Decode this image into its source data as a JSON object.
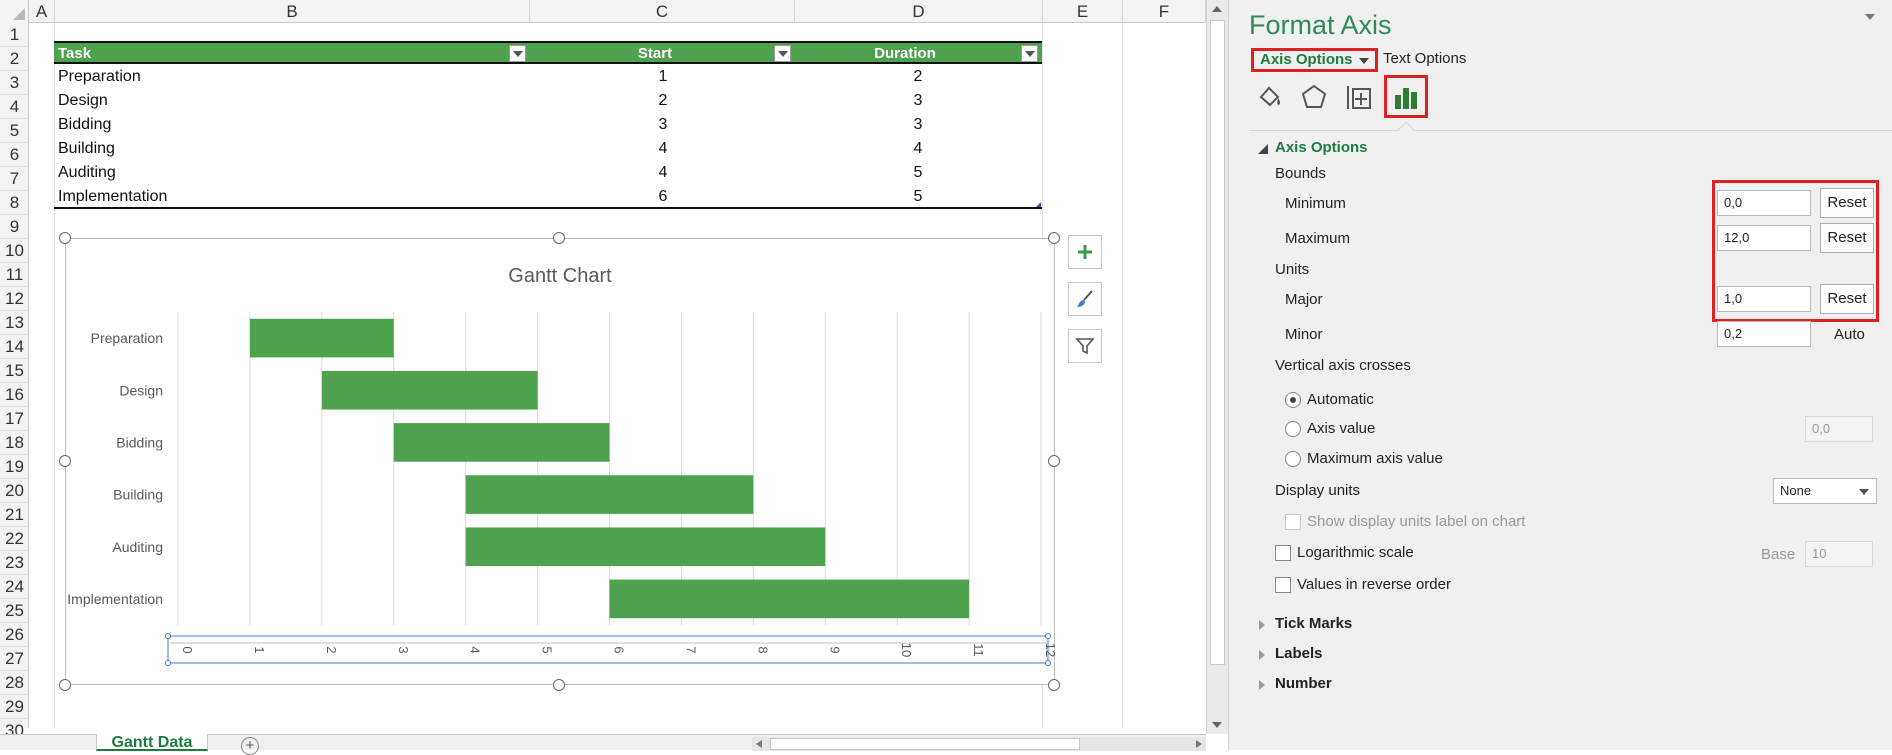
{
  "sheet": {
    "columns": [
      "A",
      "B",
      "C",
      "D",
      "E",
      "F"
    ],
    "rows": [
      "1",
      "2",
      "3",
      "4",
      "5",
      "6",
      "7",
      "8",
      "9",
      "10",
      "11",
      "12",
      "13",
      "14",
      "15",
      "16",
      "17",
      "18",
      "19",
      "20",
      "21",
      "22",
      "23",
      "24",
      "25",
      "26",
      "27",
      "28",
      "29",
      "30"
    ],
    "table": {
      "headers": [
        "Task",
        "Start",
        "Duration"
      ],
      "rows": [
        {
          "task": "Preparation",
          "start": "1",
          "duration": "2"
        },
        {
          "task": "Design",
          "start": "2",
          "duration": "3"
        },
        {
          "task": "Bidding",
          "start": "3",
          "duration": "3"
        },
        {
          "task": "Building",
          "start": "4",
          "duration": "4"
        },
        {
          "task": "Auditing",
          "start": "4",
          "duration": "5"
        },
        {
          "task": "Implementation",
          "start": "6",
          "duration": "5"
        }
      ]
    },
    "tab_label": "Gantt Data",
    "add_sheet_glyph": "+"
  },
  "chart_data": {
    "type": "bar",
    "title": "Gantt Chart",
    "orientation": "horizontal",
    "stacked": true,
    "categories": [
      "Preparation",
      "Design",
      "Bidding",
      "Building",
      "Auditing",
      "Implementation"
    ],
    "series": [
      {
        "values": [
          1,
          2,
          3,
          4,
          4,
          6
        ],
        "color": "none"
      },
      {
        "values": [
          2,
          3,
          3,
          4,
          5,
          5
        ],
        "color": "#4ea24e"
      }
    ],
    "xlim": [
      0,
      12
    ],
    "xticks": [
      0,
      1,
      2,
      3,
      4,
      5,
      6,
      7,
      8,
      9,
      10,
      11,
      12
    ],
    "xlabel": "",
    "ylabel": "",
    "grid": true,
    "legend": "none"
  },
  "chart_tools": {
    "add_icon": "plus-icon",
    "style_icon": "brush-icon",
    "filter_icon": "filter-icon"
  },
  "pane": {
    "title": "Format Axis",
    "tab_axis_options": "Axis Options",
    "tab_text_options": "Text Options",
    "icons": [
      "fill-line-icon",
      "effects-icon",
      "size-properties-icon",
      "axis-options-icon"
    ],
    "section_axis_options": "Axis Options",
    "bounds_label": "Bounds",
    "minimum_label": "Minimum",
    "minimum_value": "0,0",
    "maximum_label": "Maximum",
    "maximum_value": "12,0",
    "units_label": "Units",
    "major_label": "Major",
    "major_value": "1,0",
    "minor_label": "Minor",
    "minor_value": "0,2",
    "reset_label": "Reset",
    "auto_label": "Auto",
    "vertical_axis_crosses": "Vertical axis crosses",
    "radio_automatic": "Automatic",
    "radio_axis_value": "Axis value",
    "axis_value_input": "0,0",
    "radio_maximum": "Maximum axis value",
    "display_units": "Display units",
    "display_units_value": "None",
    "show_units_label": "Show display units label on chart",
    "log_scale": "Logarithmic scale",
    "base_label": "Base",
    "base_value": "10",
    "reverse_order": "Values in reverse order",
    "tick_marks": "Tick Marks",
    "labels": "Labels",
    "number": "Number"
  },
  "colors": {
    "accent_green": "#1e7b3e",
    "bar_green": "#4ea24e",
    "highlight_red": "#e02020"
  }
}
